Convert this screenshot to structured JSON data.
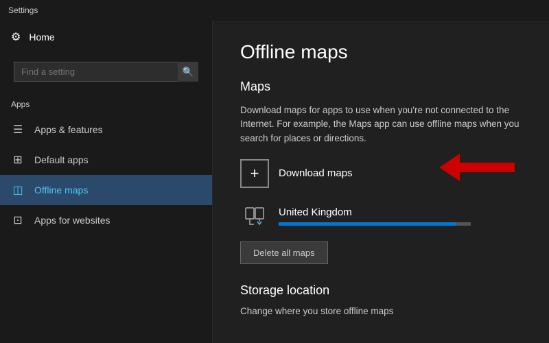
{
  "titleBar": {
    "label": "Settings"
  },
  "sidebar": {
    "homeLabel": "Home",
    "searchPlaceholder": "Find a setting",
    "sectionLabel": "Apps",
    "items": [
      {
        "id": "apps-features",
        "label": "Apps & features",
        "icon": "☰"
      },
      {
        "id": "default-apps",
        "label": "Default apps",
        "icon": "⊞"
      },
      {
        "id": "offline-maps",
        "label": "Offline maps",
        "icon": "◫",
        "active": true
      },
      {
        "id": "apps-websites",
        "label": "Apps for websites",
        "icon": "⊡"
      }
    ]
  },
  "content": {
    "pageTitle": "Offline maps",
    "mapsSectionTitle": "Maps",
    "mapsDescription": "Download maps for apps to use when you're not connected to the Internet. For example, the Maps app can use offline maps when you search for places or directions.",
    "downloadMapsLabel": "Download maps",
    "mapItem": {
      "name": "United Kingdom",
      "progressPercent": 92
    },
    "deleteButton": "Delete all maps",
    "storageSectionTitle": "Storage location",
    "storageDescription": "Change where you store offline maps"
  }
}
